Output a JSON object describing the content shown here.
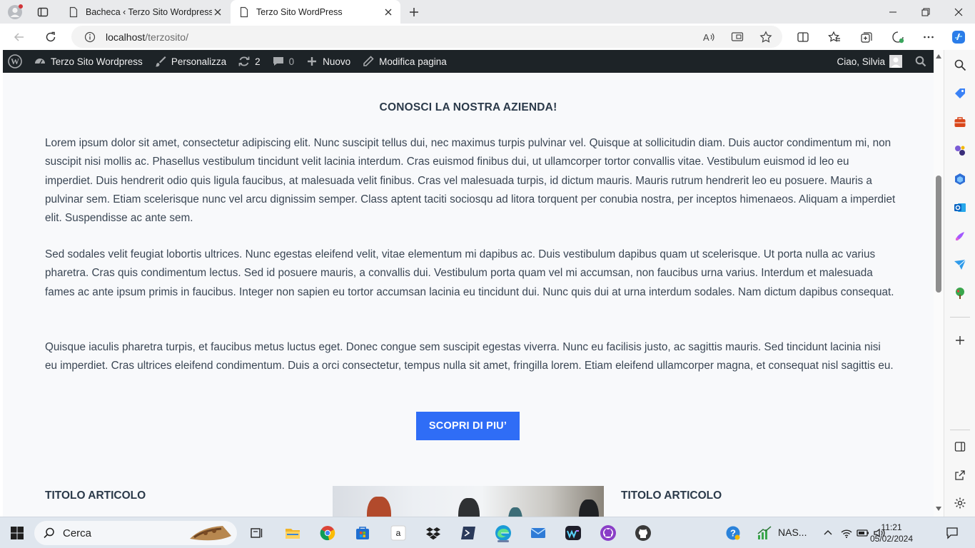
{
  "browser": {
    "tabs": [
      {
        "title": "Bacheca ‹ Terzo Sito Wordpress —",
        "active": false
      },
      {
        "title": "Terzo Sito WordPress",
        "active": true
      }
    ],
    "url": {
      "host": "localhost",
      "path": "/terzosito/"
    }
  },
  "adminbar": {
    "site_name": "Terzo Sito Wordpress",
    "customize": "Personalizza",
    "updates_count": "2",
    "comments_count": "0",
    "new_label": "Nuovo",
    "edit_label": "Modifica pagina",
    "greeting": "Ciao, Silvia"
  },
  "page": {
    "heading": "CONOSCI LA NOSTRA AZIENDA!",
    "paragraphs": [
      "Lorem ipsum dolor sit amet, consectetur adipiscing elit. Nunc suscipit tellus dui, nec maximus turpis pulvinar vel. Quisque at sollicitudin diam. Duis auctor condimentum mi, non suscipit nisi mollis ac. Phasellus vestibulum tincidunt velit lacinia interdum. Cras euismod finibus dui, ut ullamcorper tortor convallis vitae. Vestibulum euismod id leo eu imperdiet. Duis hendrerit odio quis ligula faucibus, at malesuada velit finibus. Cras vel malesuada turpis, id dictum mauris. Mauris rutrum hendrerit leo eu posuere. Mauris a pulvinar sem. Etiam scelerisque nunc vel arcu dignissim semper. Class aptent taciti sociosqu ad litora torquent per conubia nostra, per inceptos himenaeos. Aliquam a imperdiet elit. Suspendisse ac ante sem.",
      "Sed sodales velit feugiat lobortis ultrices. Nunc egestas eleifend velit, vitae elementum mi dapibus ac. Duis vestibulum dapibus quam ut scelerisque. Ut porta nulla ac varius pharetra. Cras quis condimentum lectus. Sed id posuere mauris, a convallis dui. Vestibulum porta quam vel mi accumsan, non faucibus urna varius. Interdum et malesuada fames ac ante ipsum primis in faucibus. Integer non sapien eu tortor accumsan lacinia eu tincidunt dui. Nunc quis dui at urna interdum sodales. Nam dictum dapibus consequat.",
      "Quisque iaculis pharetra turpis, et faucibus metus luctus eget. Donec congue sem suscipit egestas viverra. Nunc eu facilisis justo, ac sagittis mauris. Sed tincidunt lacinia nisi eu imperdiet. Cras ultrices eleifend condimentum. Duis a orci consectetur, tempus nulla sit amet, fringilla lorem. Etiam eleifend ullamcorper magna, et consequat nisl sagittis eu."
    ],
    "cta_label": "SCOPRI DI PIU’",
    "article_titles": [
      "TITOLO ARTICOLO",
      "TITOLO ARTICOLO"
    ]
  },
  "taskbar": {
    "search_label": "Cerca",
    "tray_label": "NAS...",
    "time": "11:21",
    "date": "05/02/2024"
  },
  "colors": {
    "accent_button": "#2f6df6",
    "adminbar_bg": "#1d2327",
    "page_bg": "#f8f9fb"
  }
}
